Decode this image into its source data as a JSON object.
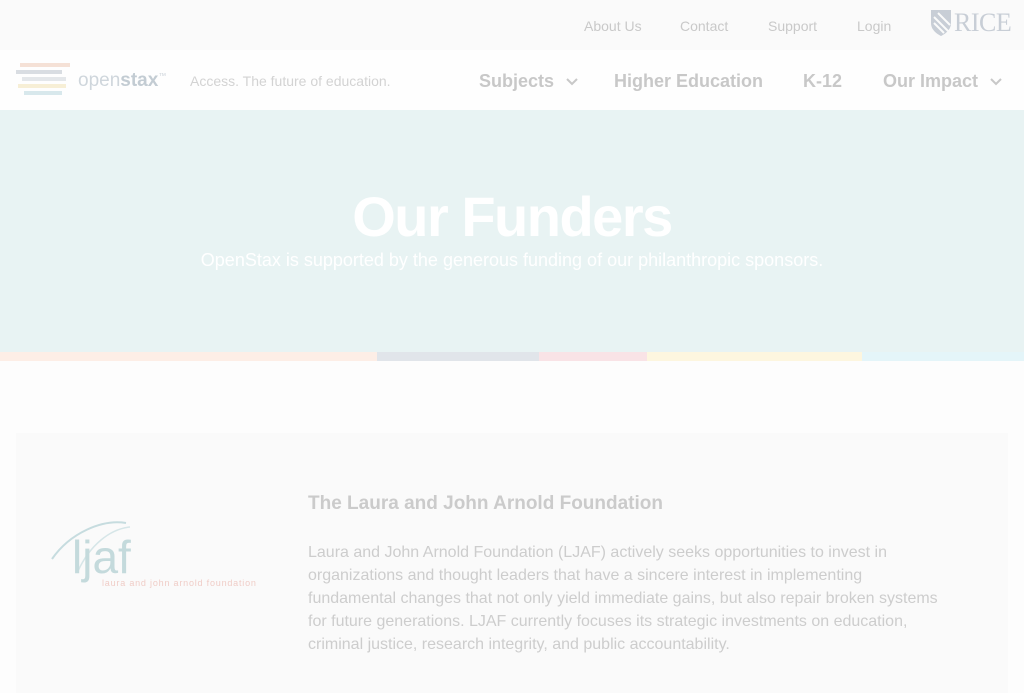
{
  "utility": {
    "links": [
      "About Us",
      "Contact",
      "Support",
      "Login"
    ],
    "partner_logo": "RICE"
  },
  "brand": {
    "name_light": "open",
    "name_bold": "stax",
    "trademark": "™",
    "tagline": "Access. The future of education."
  },
  "nav": {
    "items": [
      {
        "label": "Subjects",
        "icon": "chevron-down-icon"
      },
      {
        "label": "Higher Education"
      },
      {
        "label": "K-12"
      },
      {
        "label": "Our Impact",
        "icon": "chevron-down-icon"
      }
    ]
  },
  "hero": {
    "title": "Our Funders",
    "subtitle": "OpenStax is supported by the generous funding of our philanthropic sponsors."
  },
  "stripe_colors": [
    "#fdeee6",
    "#e1e5ea",
    "#f9e3e6",
    "#fdf6df",
    "#e4f5f9"
  ],
  "funder": {
    "logo_text": "ljaf",
    "logo_subtext": "laura and john arnold foundation",
    "title": "The Laura and John Arnold Foundation",
    "description": "Laura and John Arnold Foundation (LJAF) actively seeks opportunities to invest in organizations and thought leaders that have a sincere interest in implementing fundamental changes that not only yield immediate gains, but also repair broken systems for future generations. LJAF currently focuses its strategic investments on education, criminal justice, research integrity, and public accountability."
  }
}
